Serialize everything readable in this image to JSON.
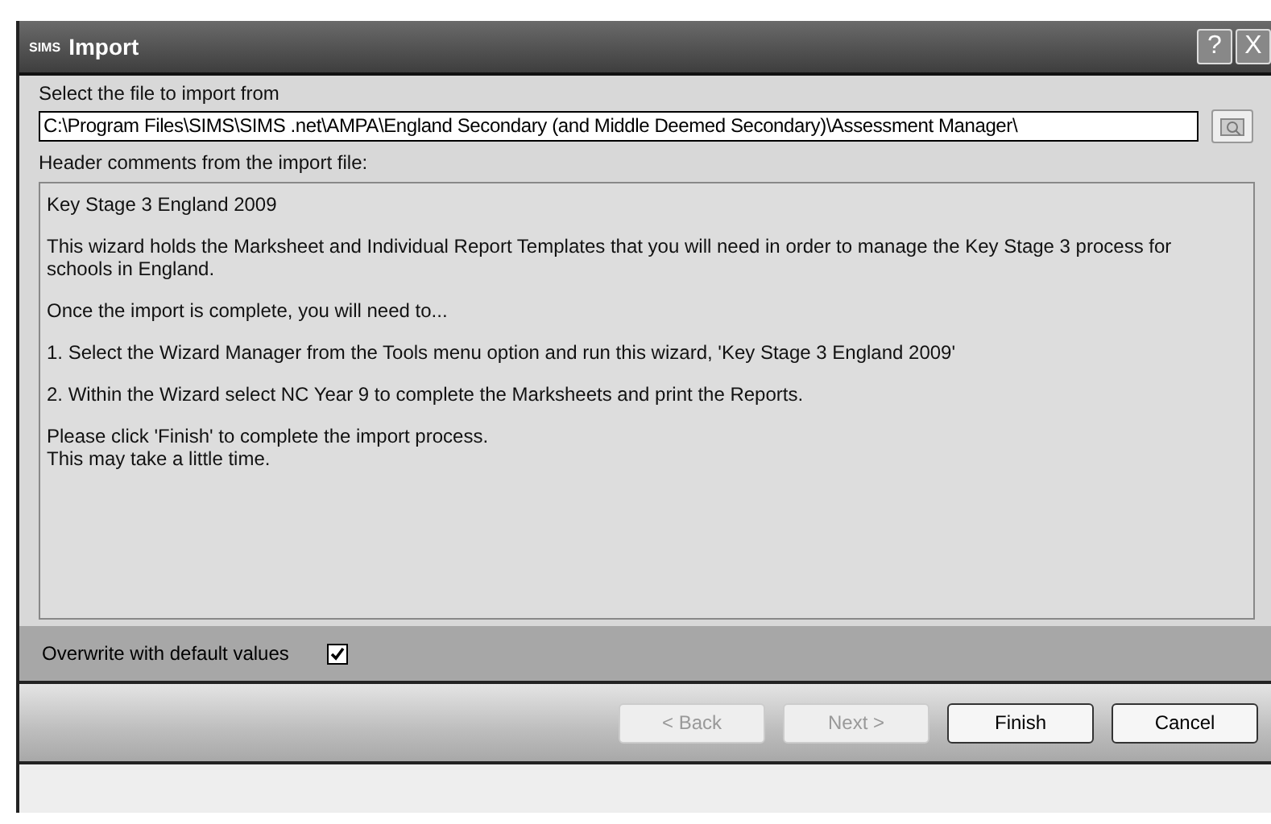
{
  "window": {
    "logo": "SIMS",
    "title": "Import",
    "help": "?",
    "close": "X"
  },
  "file": {
    "label": "Select the file to import from",
    "value": "C:\\Program Files\\SIMS\\SIMS .net\\AMPA\\England Secondary (and Middle Deemed Secondary)\\Assessment Manager\\"
  },
  "comments": {
    "label": "Header comments from the import file:",
    "paragraphs": [
      "Key Stage 3 England 2009",
      "This wizard holds the Marksheet and Individual Report Templates that you will need in order to manage the Key Stage 3 process for schools in England.",
      "Once the import is complete, you will need to...",
      "1.  Select the Wizard Manager from the Tools menu option and run this wizard, 'Key Stage 3 England 2009'",
      "2.  Within the Wizard select NC Year 9 to complete the Marksheets and print the Reports.",
      "Please click 'Finish' to complete the import process.\nThis may take a little time."
    ]
  },
  "overwrite": {
    "label": "Overwrite with default values",
    "checked": true
  },
  "buttons": [
    {
      "label": "< Back",
      "disabled": true
    },
    {
      "label": "Next >",
      "disabled": true
    },
    {
      "label": "Finish",
      "disabled": false
    },
    {
      "label": "Cancel",
      "disabled": false
    }
  ]
}
